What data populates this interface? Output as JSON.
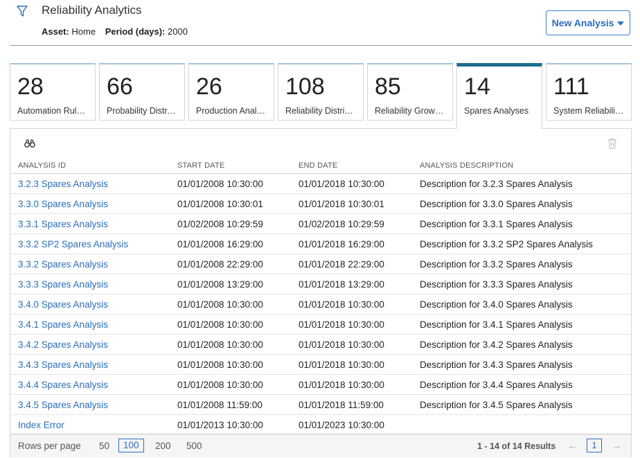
{
  "header": {
    "title": "Reliability Analytics",
    "asset_label": "Asset:",
    "asset_value": "Home",
    "period_label": "Period (days):",
    "period_value": "2000",
    "new_button": "New Analysis"
  },
  "tiles": [
    {
      "count": "28",
      "label": "Automation Rul…"
    },
    {
      "count": "66",
      "label": "Probability Distr…"
    },
    {
      "count": "26",
      "label": "Production Anal…"
    },
    {
      "count": "108",
      "label": "Reliability Distri…"
    },
    {
      "count": "85",
      "label": "Reliability Grow…"
    },
    {
      "count": "14",
      "label": "Spares Analyses"
    },
    {
      "count": "111",
      "label": "System Reliabili…"
    }
  ],
  "table": {
    "columns": [
      "ANALYSIS ID",
      "START DATE",
      "END DATE",
      "ANALYSIS DESCRIPTION"
    ],
    "rows": [
      [
        "3.2.3 Spares Analysis",
        "01/01/2008 10:30:00",
        "01/01/2018 10:30:00",
        "Description for 3.2.3 Spares Analysis"
      ],
      [
        "3.3.0 Spares Analysis",
        "01/01/2008 10:30:01",
        "01/01/2018 10:30:01",
        "Description for 3.3.0 Spares Analysis"
      ],
      [
        "3.3.1 Spares Analysis",
        "01/02/2008 10:29:59",
        "01/02/2018 10:29:59",
        "Description for 3.3.1 Spares Analysis"
      ],
      [
        "3.3.2 SP2 Spares Analysis",
        "01/01/2008 16:29:00",
        "01/01/2018 16:29:00",
        "Description for 3.3.2 SP2 Spares Analysis"
      ],
      [
        "3.3.2 Spares Analysis",
        "01/01/2008 22:29:00",
        "01/01/2018 22:29:00",
        "Description for 3.3.2 Spares Analysis"
      ],
      [
        "3.3.3 Spares Analysis",
        "01/01/2008 13:29:00",
        "01/01/2018 13:29:00",
        "Description for 3.3.3 Spares Analysis"
      ],
      [
        "3.4.0 Spares Analysis",
        "01/01/2008 10:30:00",
        "01/01/2018 10:30:00",
        "Description for 3.4.0 Spares Analysis"
      ],
      [
        "3.4.1 Spares Analysis",
        "01/01/2008 10:30:00",
        "01/01/2018 10:30:00",
        "Description for 3.4.1 Spares Analysis"
      ],
      [
        "3.4.2 Spares Analysis",
        "01/01/2008 10:30:00",
        "01/01/2018 10:30:00",
        "Description for 3.4.2 Spares Analysis"
      ],
      [
        "3.4.3 Spares Analysis",
        "01/01/2008 10:30:00",
        "01/01/2018 10:30:00",
        "Description for 3.4.3 Spares Analysis"
      ],
      [
        "3.4.4 Spares Analysis",
        "01/01/2008 10:30:00",
        "01/01/2018 10:30:00",
        "Description for 3.4.4 Spares Analysis"
      ],
      [
        "3.4.5 Spares Analysis",
        "01/01/2008 11:59:00",
        "01/01/2018 11:59:00",
        "Description for 3.4.5 Spares Analysis"
      ],
      [
        "Index Error",
        "01/01/2013 10:30:00",
        "01/01/2023 10:30:00",
        ""
      ]
    ]
  },
  "footer": {
    "rows_per_page_label": "Rows per page",
    "options": [
      "50",
      "100",
      "200",
      "500"
    ],
    "results": "1 - 14 of 14 Results",
    "current_page": "1",
    "prev_arrow": "←",
    "next_arrow": "→"
  }
}
